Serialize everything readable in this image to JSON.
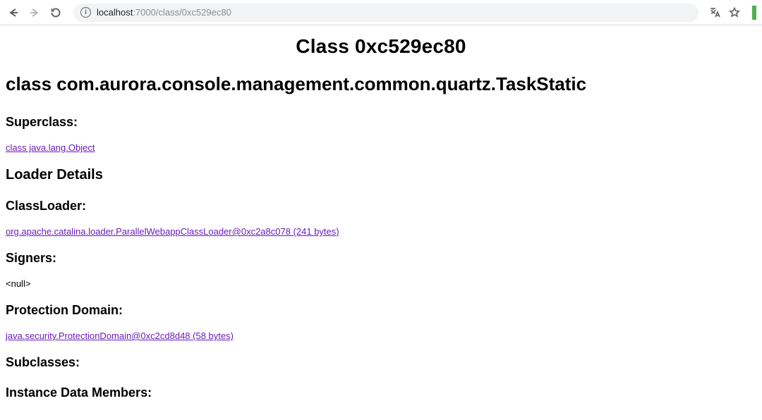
{
  "browser": {
    "url_host": "localhost",
    "url_port_path": ":7000/class/0xc529ec80"
  },
  "page": {
    "title": "Class 0xc529ec80",
    "class_heading": "class com.aurora.console.management.common.quartz.TaskStatic",
    "superclass": {
      "label": "Superclass:",
      "link_text": "class java.lang.Object"
    },
    "loader_details": {
      "heading": "Loader Details",
      "classloader_label": "ClassLoader:",
      "classloader_link": "org.apache.catalina.loader.ParallelWebappClassLoader@0xc2a8c078 (241 bytes)",
      "signers_label": "Signers:",
      "signers_value": "<null>",
      "protection_domain_label": "Protection Domain:",
      "protection_domain_link": "java.security.ProtectionDomain@0xc2cd8d48 (58 bytes)"
    },
    "subclasses_heading": "Subclasses:",
    "instance_members_heading": "Instance Data Members:"
  }
}
